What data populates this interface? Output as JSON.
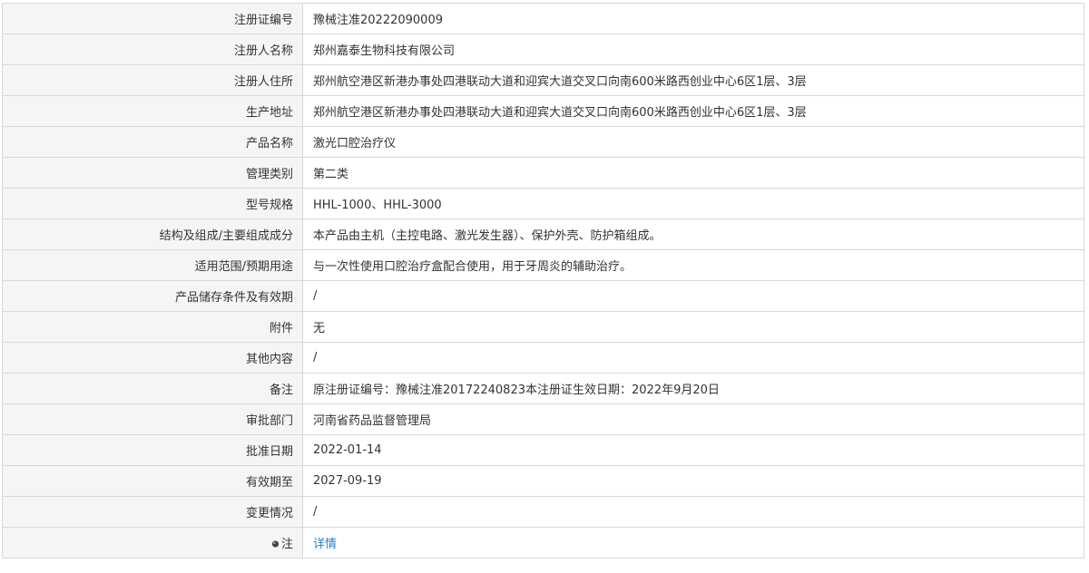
{
  "rows": [
    {
      "label": "注册证编号",
      "value": "豫械注准20222090009"
    },
    {
      "label": "注册人名称",
      "value": "郑州嘉泰生物科技有限公司"
    },
    {
      "label": "注册人住所",
      "value": "郑州航空港区新港办事处四港联动大道和迎宾大道交叉口向南600米路西创业中心6区1层、3层"
    },
    {
      "label": "生产地址",
      "value": "郑州航空港区新港办事处四港联动大道和迎宾大道交叉口向南600米路西创业中心6区1层、3层"
    },
    {
      "label": "产品名称",
      "value": "激光口腔治疗仪"
    },
    {
      "label": "管理类别",
      "value": "第二类"
    },
    {
      "label": "型号规格",
      "value": "HHL-1000、HHL-3000"
    },
    {
      "label": "结构及组成/主要组成成分",
      "value": "本产品由主机（主控电路、激光发生器）、保护外壳、防护箱组成。"
    },
    {
      "label": "适用范围/预期用途",
      "value": "与一次性使用口腔治疗盒配合使用，用于牙周炎的辅助治疗。"
    },
    {
      "label": "产品储存条件及有效期",
      "value": "/"
    },
    {
      "label": "附件",
      "value": "无"
    },
    {
      "label": "其他内容",
      "value": "/"
    },
    {
      "label": "备注",
      "value": "原注册证编号：豫械注准20172240823本注册证生效日期：2022年9月20日"
    },
    {
      "label": "审批部门",
      "value": "河南省药品监督管理局"
    },
    {
      "label": "批准日期",
      "value": "2022-01-14"
    },
    {
      "label": "有效期至",
      "value": "2027-09-19"
    },
    {
      "label": "变更情况",
      "value": "/"
    }
  ],
  "note_row": {
    "icon": "pin-icon",
    "label": "注",
    "link_text": "详情"
  },
  "colors": {
    "label_bg": "#f5f5f5",
    "border": "#d8d8d8",
    "text": "#333333",
    "link": "#2a7ec9"
  }
}
